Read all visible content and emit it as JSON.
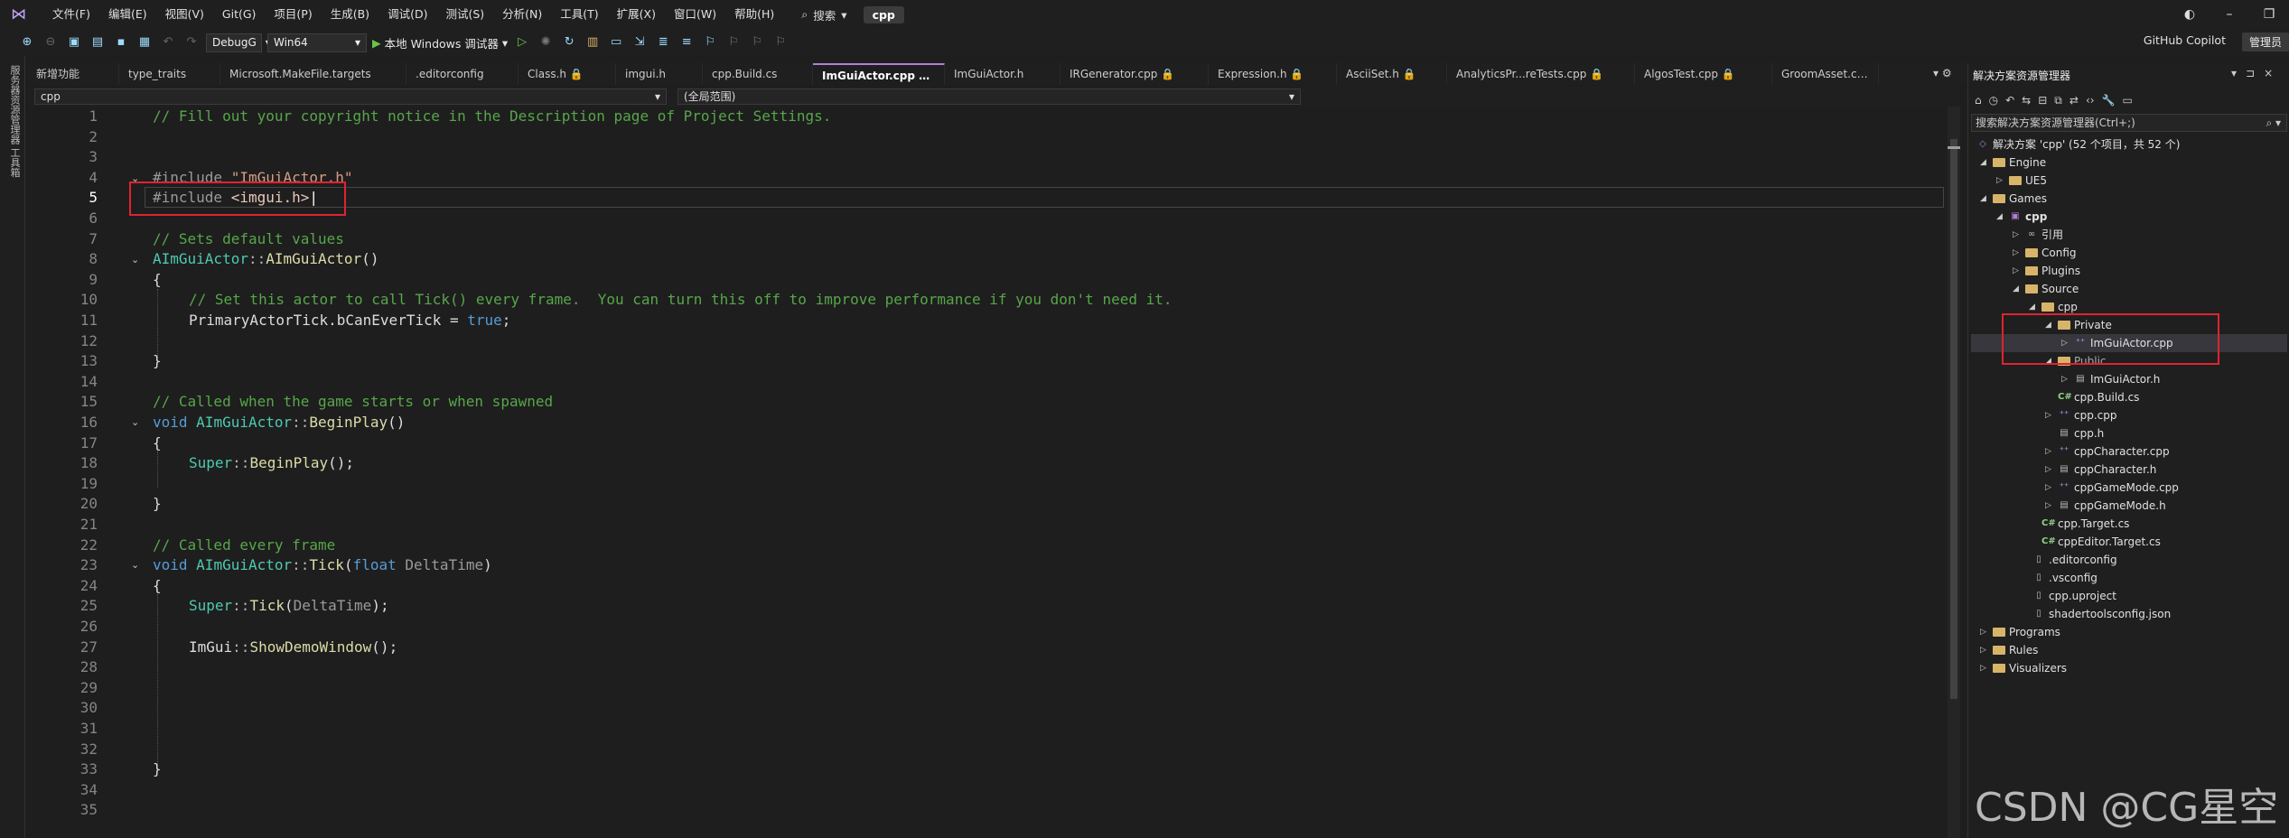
{
  "menu": {
    "items": [
      "文件(F)",
      "编辑(E)",
      "视图(V)",
      "Git(G)",
      "项目(P)",
      "生成(B)",
      "调试(D)",
      "测试(S)",
      "分析(N)",
      "工具(T)",
      "扩展(X)",
      "窗口(W)",
      "帮助(H)"
    ],
    "search_label": "搜索",
    "project_name": "cpp"
  },
  "toolbar": {
    "config": "DebugG",
    "platform": "Win64",
    "run_label": "本地 Windows 调试器",
    "copilot_label": "GitHub Copilot",
    "feedback_label": "管理员"
  },
  "left_strip": {
    "label": "服务器资源管理器  工具箱"
  },
  "tabs": [
    {
      "label": "新增功能"
    },
    {
      "label": "type_traits"
    },
    {
      "label": "Microsoft.MakeFile.targets"
    },
    {
      "label": ".editorconfig"
    },
    {
      "label": "Class.h 🔒"
    },
    {
      "label": "imgui.h"
    },
    {
      "label": "cpp.Build.cs"
    },
    {
      "label": "ImGuiActor.cpp ⊕ ×"
    },
    {
      "label": "ImGuiActor.h"
    },
    {
      "label": "IRGenerator.cpp 🔒"
    },
    {
      "label": "Expression.h 🔒"
    },
    {
      "label": "AsciiSet.h 🔒"
    },
    {
      "label": "AnalyticsPr...reTests.cpp 🔒"
    },
    {
      "label": "AlgosTest.cpp 🔒"
    },
    {
      "label": "GroomAsset.cpp"
    }
  ],
  "navbar": {
    "project": "cpp",
    "scope": "(全局范围)"
  },
  "editor": {
    "line_numbers": [
      "1",
      "2",
      "3",
      "4",
      "5",
      "6",
      "7",
      "8",
      "9",
      "10",
      "11",
      "12",
      "13",
      "14",
      "15",
      "16",
      "17",
      "18",
      "19",
      "20",
      "21",
      "22",
      "23",
      "24",
      "25",
      "26",
      "27",
      "28",
      "29",
      "30",
      "31",
      "32",
      "33",
      "34",
      "35"
    ],
    "current_line": "5",
    "code": {
      "l1": "// Fill out your copyright notice in the Description page of Project Settings.",
      "l4_directive": "#include ",
      "l4_file": "\"ImGuiActor.h\"",
      "l5_directive": "#include ",
      "l5_file": "<imgui.h>",
      "l7": "// Sets default values",
      "l8_class": "AImGuiActor",
      "l8_sep": "::",
      "l8_fn": "AImGuiActor",
      "l8_paren": "()",
      "brace_open": "{",
      "brace_close": "}",
      "l10": "// Set this actor to call Tick() every frame.  You can turn this off to improve performance if you don't need it.",
      "l11_a": "PrimaryActorTick",
      "l11_b": ".bCanEverTick = ",
      "l11_c": "true",
      "l11_d": ";",
      "l15": "// Called when the game starts or when spawned",
      "kw_void": "void",
      "l16_fn": "BeginPlay",
      "super": "Super",
      "l18_rest": "();",
      "l22": "// Called every frame",
      "l23_fn": "Tick",
      "kw_float": "float",
      "param": "DeltaTime",
      "l27_ns": "ImGui",
      "l27_fn": "ShowDemoWindow",
      "l27_rest": "();"
    }
  },
  "solution": {
    "title": "解决方案资源管理器",
    "search_placeholder": "搜索解决方案资源管理器(Ctrl+;)",
    "tree": [
      {
        "label": "解决方案 'cpp' (52 个项目，共 52 个)"
      },
      {
        "label": "Engine"
      },
      {
        "label": "UE5"
      },
      {
        "label": "Games"
      },
      {
        "label": "cpp"
      },
      {
        "label": "引用"
      },
      {
        "label": "Config"
      },
      {
        "label": "Plugins"
      },
      {
        "label": "Source"
      },
      {
        "label": "cpp"
      },
      {
        "label": "Private"
      },
      {
        "label": "ImGuiActor.cpp"
      },
      {
        "label": "Public"
      },
      {
        "label": "ImGuiActor.h"
      },
      {
        "label": "cpp.Build.cs"
      },
      {
        "label": "cpp.cpp"
      },
      {
        "label": "cpp.h"
      },
      {
        "label": "cppCharacter.cpp"
      },
      {
        "label": "cppCharacter.h"
      },
      {
        "label": "cppGameMode.cpp"
      },
      {
        "label": "cppGameMode.h"
      },
      {
        "label": "cpp.Target.cs"
      },
      {
        "label": "cppEditor.Target.cs"
      },
      {
        "label": ".editorconfig"
      },
      {
        "label": ".vsconfig"
      },
      {
        "label": "cpp.uproject"
      },
      {
        "label": "shadertoolsconfig.json"
      },
      {
        "label": "Programs"
      },
      {
        "label": "Rules"
      },
      {
        "label": "Visualizers"
      }
    ]
  },
  "watermark": "CSDN @CG星空"
}
